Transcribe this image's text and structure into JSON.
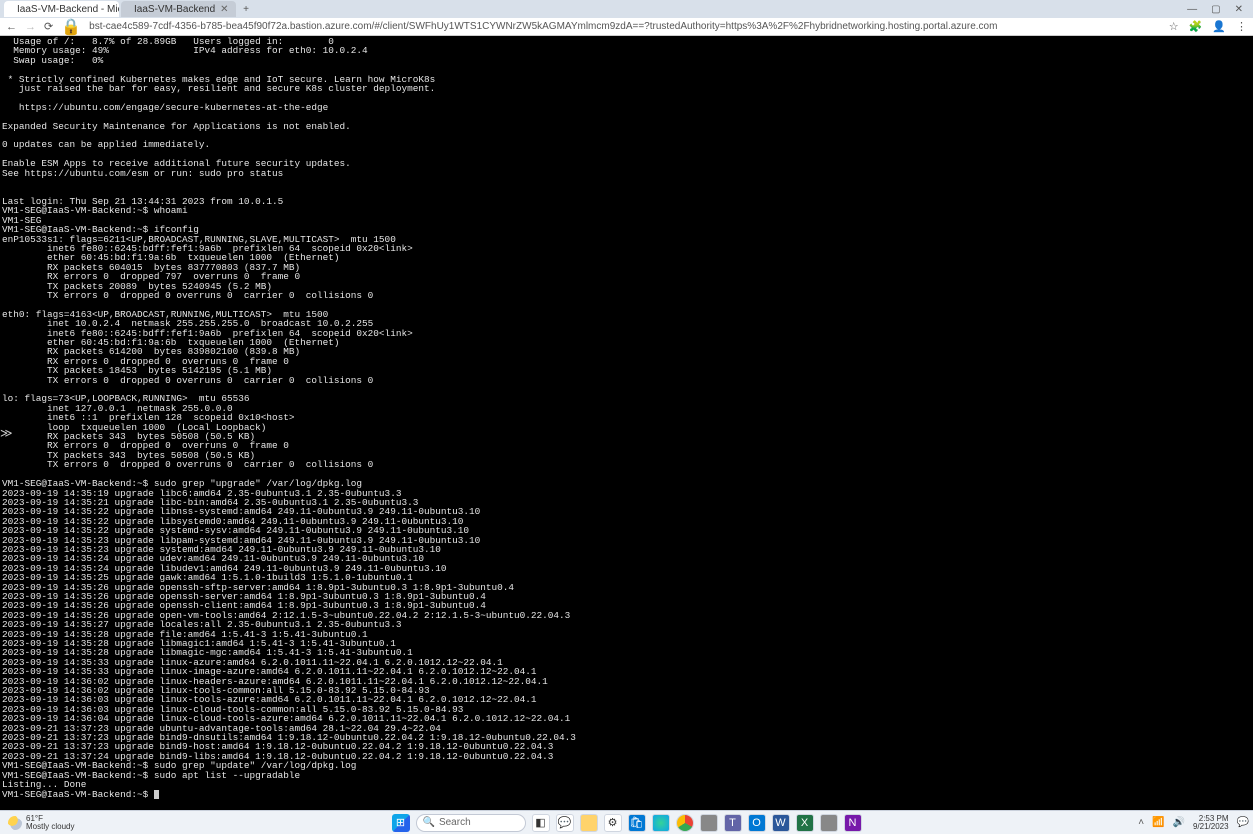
{
  "browser": {
    "tabs": [
      {
        "title": "IaaS-VM-Backend - Microsoft A",
        "active": true
      },
      {
        "title": "IaaS-VM-Backend",
        "active": false
      }
    ],
    "url": "bst-cae4c589-7cdf-4356-b785-bea45f90f72a.bastion.azure.com/#/client/SWFhUy1WTS1CYWNrZW5kAGMAYmlmcm9zdA==?trustedAuthority=https%3A%2F%2Fhybridnetworking.hosting.portal.azure.com"
  },
  "terminal": {
    "lines": [
      "  Usage of /:   8.7% of 28.89GB   Users logged in:        0",
      "  Memory usage: 49%               IPv4 address for eth0: 10.0.2.4",
      "  Swap usage:   0%",
      "",
      " * Strictly confined Kubernetes makes edge and IoT secure. Learn how MicroK8s",
      "   just raised the bar for easy, resilient and secure K8s cluster deployment.",
      "",
      "   https://ubuntu.com/engage/secure-kubernetes-at-the-edge",
      "",
      "Expanded Security Maintenance for Applications is not enabled.",
      "",
      "0 updates can be applied immediately.",
      "",
      "Enable ESM Apps to receive additional future security updates.",
      "See https://ubuntu.com/esm or run: sudo pro status",
      "",
      "",
      "Last login: Thu Sep 21 13:44:31 2023 from 10.0.1.5",
      "VM1-SEG@IaaS-VM-Backend:~$ whoami",
      "VM1-SEG",
      "VM1-SEG@IaaS-VM-Backend:~$ ifconfig",
      "enP10533s1: flags=6211<UP,BROADCAST,RUNNING,SLAVE,MULTICAST>  mtu 1500",
      "        inet6 fe80::6245:bdff:fef1:9a6b  prefixlen 64  scopeid 0x20<link>",
      "        ether 60:45:bd:f1:9a:6b  txqueuelen 1000  (Ethernet)",
      "        RX packets 604015  bytes 837770803 (837.7 MB)",
      "        RX errors 0  dropped 797  overruns 0  frame 0",
      "        TX packets 20089  bytes 5240945 (5.2 MB)",
      "        TX errors 0  dropped 0 overruns 0  carrier 0  collisions 0",
      "",
      "eth0: flags=4163<UP,BROADCAST,RUNNING,MULTICAST>  mtu 1500",
      "        inet 10.0.2.4  netmask 255.255.255.0  broadcast 10.0.2.255",
      "        inet6 fe80::6245:bdff:fef1:9a6b  prefixlen 64  scopeid 0x20<link>",
      "        ether 60:45:bd:f1:9a:6b  txqueuelen 1000  (Ethernet)",
      "        RX packets 614200  bytes 839802100 (839.8 MB)",
      "        RX errors 0  dropped 0  overruns 0  frame 0",
      "        TX packets 18453  bytes 5142195 (5.1 MB)",
      "        TX errors 0  dropped 0 overruns 0  carrier 0  collisions 0",
      "",
      "lo: flags=73<UP,LOOPBACK,RUNNING>  mtu 65536",
      "        inet 127.0.0.1  netmask 255.0.0.0",
      "        inet6 ::1  prefixlen 128  scopeid 0x10<host>",
      "        loop  txqueuelen 1000  (Local Loopback)",
      "        RX packets 343  bytes 50508 (50.5 KB)",
      "        RX errors 0  dropped 0  overruns 0  frame 0",
      "        TX packets 343  bytes 50508 (50.5 KB)",
      "        TX errors 0  dropped 0 overruns 0  carrier 0  collisions 0",
      "",
      "VM1-SEG@IaaS-VM-Backend:~$ sudo grep \"upgrade\" /var/log/dpkg.log",
      "2023-09-19 14:35:19 upgrade libc6:amd64 2.35-0ubuntu3.1 2.35-0ubuntu3.3",
      "2023-09-19 14:35:21 upgrade libc-bin:amd64 2.35-0ubuntu3.1 2.35-0ubuntu3.3",
      "2023-09-19 14:35:22 upgrade libnss-systemd:amd64 249.11-0ubuntu3.9 249.11-0ubuntu3.10",
      "2023-09-19 14:35:22 upgrade libsystemd0:amd64 249.11-0ubuntu3.9 249.11-0ubuntu3.10",
      "2023-09-19 14:35:22 upgrade systemd-sysv:amd64 249.11-0ubuntu3.9 249.11-0ubuntu3.10",
      "2023-09-19 14:35:23 upgrade libpam-systemd:amd64 249.11-0ubuntu3.9 249.11-0ubuntu3.10",
      "2023-09-19 14:35:23 upgrade systemd:amd64 249.11-0ubuntu3.9 249.11-0ubuntu3.10",
      "2023-09-19 14:35:24 upgrade udev:amd64 249.11-0ubuntu3.9 249.11-0ubuntu3.10",
      "2023-09-19 14:35:24 upgrade libudev1:amd64 249.11-0ubuntu3.9 249.11-0ubuntu3.10",
      "2023-09-19 14:35:25 upgrade gawk:amd64 1:5.1.0-1build3 1:5.1.0-1ubuntu0.1",
      "2023-09-19 14:35:26 upgrade openssh-sftp-server:amd64 1:8.9p1-3ubuntu0.3 1:8.9p1-3ubuntu0.4",
      "2023-09-19 14:35:26 upgrade openssh-server:amd64 1:8.9p1-3ubuntu0.3 1:8.9p1-3ubuntu0.4",
      "2023-09-19 14:35:26 upgrade openssh-client:amd64 1:8.9p1-3ubuntu0.3 1:8.9p1-3ubuntu0.4",
      "2023-09-19 14:35:26 upgrade open-vm-tools:amd64 2:12.1.5-3~ubuntu0.22.04.2 2:12.1.5-3~ubuntu0.22.04.3",
      "2023-09-19 14:35:27 upgrade locales:all 2.35-0ubuntu3.1 2.35-0ubuntu3.3",
      "2023-09-19 14:35:28 upgrade file:amd64 1:5.41-3 1:5.41-3ubuntu0.1",
      "2023-09-19 14:35:28 upgrade libmagic1:amd64 1:5.41-3 1:5.41-3ubuntu0.1",
      "2023-09-19 14:35:28 upgrade libmagic-mgc:amd64 1:5.41-3 1:5.41-3ubuntu0.1",
      "2023-09-19 14:35:33 upgrade linux-azure:amd64 6.2.0.1011.11~22.04.1 6.2.0.1012.12~22.04.1",
      "2023-09-19 14:35:33 upgrade linux-image-azure:amd64 6.2.0.1011.11~22.04.1 6.2.0.1012.12~22.04.1",
      "2023-09-19 14:36:02 upgrade linux-headers-azure:amd64 6.2.0.1011.11~22.04.1 6.2.0.1012.12~22.04.1",
      "2023-09-19 14:36:02 upgrade linux-tools-common:all 5.15.0-83.92 5.15.0-84.93",
      "2023-09-19 14:36:03 upgrade linux-tools-azure:amd64 6.2.0.1011.11~22.04.1 6.2.0.1012.12~22.04.1",
      "2023-09-19 14:36:03 upgrade linux-cloud-tools-common:all 5.15.0-83.92 5.15.0-84.93",
      "2023-09-19 14:36:04 upgrade linux-cloud-tools-azure:amd64 6.2.0.1011.11~22.04.1 6.2.0.1012.12~22.04.1",
      "2023-09-21 13:37:23 upgrade ubuntu-advantage-tools:amd64 28.1~22.04 29.4~22.04",
      "2023-09-21 13:37:23 upgrade bind9-dnsutils:amd64 1:9.18.12-0ubuntu0.22.04.2 1:9.18.12-0ubuntu0.22.04.3",
      "2023-09-21 13:37:23 upgrade bind9-host:amd64 1:9.18.12-0ubuntu0.22.04.2 1:9.18.12-0ubuntu0.22.04.3",
      "2023-09-21 13:37:24 upgrade bind9-libs:amd64 1:9.18.12-0ubuntu0.22.04.2 1:9.18.12-0ubuntu0.22.04.3",
      "VM1-SEG@IaaS-VM-Backend:~$ sudo grep \"update\" /var/log/dpkg.log",
      "VM1-SEG@IaaS-VM-Backend:~$ sudo apt list --upgradable",
      "Listing... Done",
      "VM1-SEG@IaaS-VM-Backend:~$ "
    ]
  },
  "taskbar": {
    "weather_temp": "61°F",
    "weather_desc": "Mostly cloudy",
    "search_placeholder": "Search",
    "time": "2:53 PM",
    "date": "9/21/2023"
  }
}
